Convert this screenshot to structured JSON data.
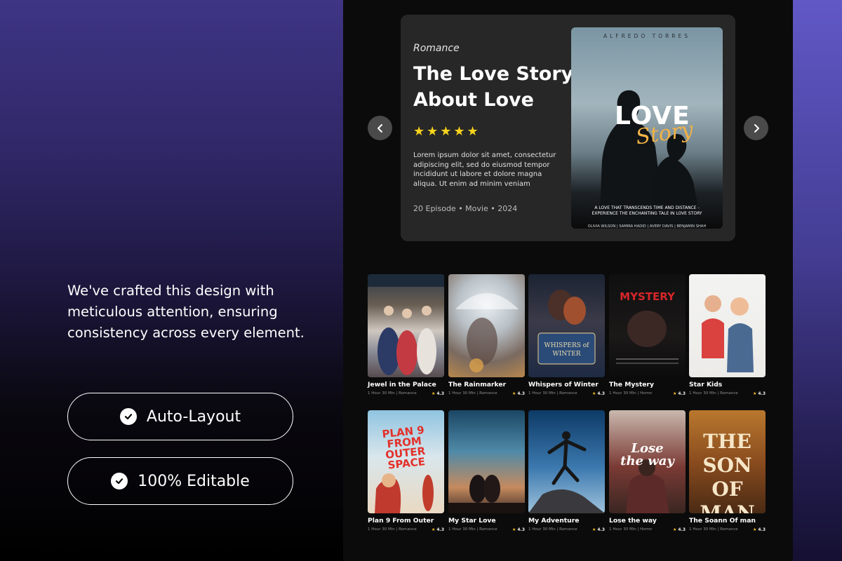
{
  "left_panel": {
    "tagline": "We've crafted this design with meticulous attention, ensuring consistency across every element.",
    "features": [
      {
        "label": "Auto-Layout",
        "icon": "check-circle-icon"
      },
      {
        "label": "100% Editable",
        "icon": "check-circle-icon"
      }
    ]
  },
  "hero": {
    "genre": "Romance",
    "title": "The Love Story About Love",
    "rating": 5,
    "stars": "★★★★★",
    "description": "Lorem ipsum dolor sit amet, consectetur adipiscing elit, sed do eiusmod tempor incididunt ut labore et dolore magna aliqua. Ut enim ad minim veniam",
    "meta": "20 Episode • Movie • 2024",
    "poster": {
      "credit": "ALFREDO TORRES",
      "title_love": "LOVE",
      "title_story": "Story",
      "tagline": "A LOVE THAT TRANSCENDS TIME AND DISTANCE - EXPERIENCE THE ENCHANTING TALE IN LOVE STORY",
      "cast": "OLIVIA WILSON | SAMIRA HADID | AVERY DAVIS | BENJAMIN SHAH"
    },
    "nav": {
      "prev": "‹",
      "next": "›"
    }
  },
  "movies": [
    {
      "title": "Jewel in the Palace",
      "meta": "1 Hour 30 Min | Romance",
      "rating": "4.3",
      "poster_text": ""
    },
    {
      "title": "The Rainmarker",
      "meta": "1 Hour 30 Min | Romance",
      "rating": "4.3",
      "poster_text": ""
    },
    {
      "title": "Whispers of Winter",
      "meta": "1 Hour 30 Min | Romance",
      "rating": "4.3",
      "poster_text": "WHISPERS of WINTER"
    },
    {
      "title": "The Mystery",
      "meta": "1 Hour 30 Min | Horror",
      "rating": "4.3",
      "poster_text": "MYSTERY"
    },
    {
      "title": "Star Kids",
      "meta": "1 Hour 30 Min | Romance",
      "rating": "4.3",
      "poster_text": ""
    },
    {
      "title": "Plan 9 From Outer",
      "meta": "1 Hour 30 Min | Romance",
      "rating": "4.3",
      "poster_text": "PLAN 9 FROM OUTER SPACE"
    },
    {
      "title": "My Star Love",
      "meta": "1 Hour 30 Min | Romance",
      "rating": "4.3",
      "poster_text": ""
    },
    {
      "title": "My Adventure",
      "meta": "1 Hour 30 Min | Romance",
      "rating": "4.3",
      "poster_text": ""
    },
    {
      "title": "Lose the way",
      "meta": "1 Hour 30 Min | Horror",
      "rating": "4.3",
      "poster_text": "Lose the way"
    },
    {
      "title": "The Soann Of man",
      "meta": "1 Hour 30 Min | Romance",
      "rating": "4.3",
      "poster_text": "THE SON OF MAN"
    }
  ],
  "colors": {
    "accent_star": "#f8d31d",
    "card_bg": "#272727",
    "screen_bg": "#0b0b0b"
  }
}
